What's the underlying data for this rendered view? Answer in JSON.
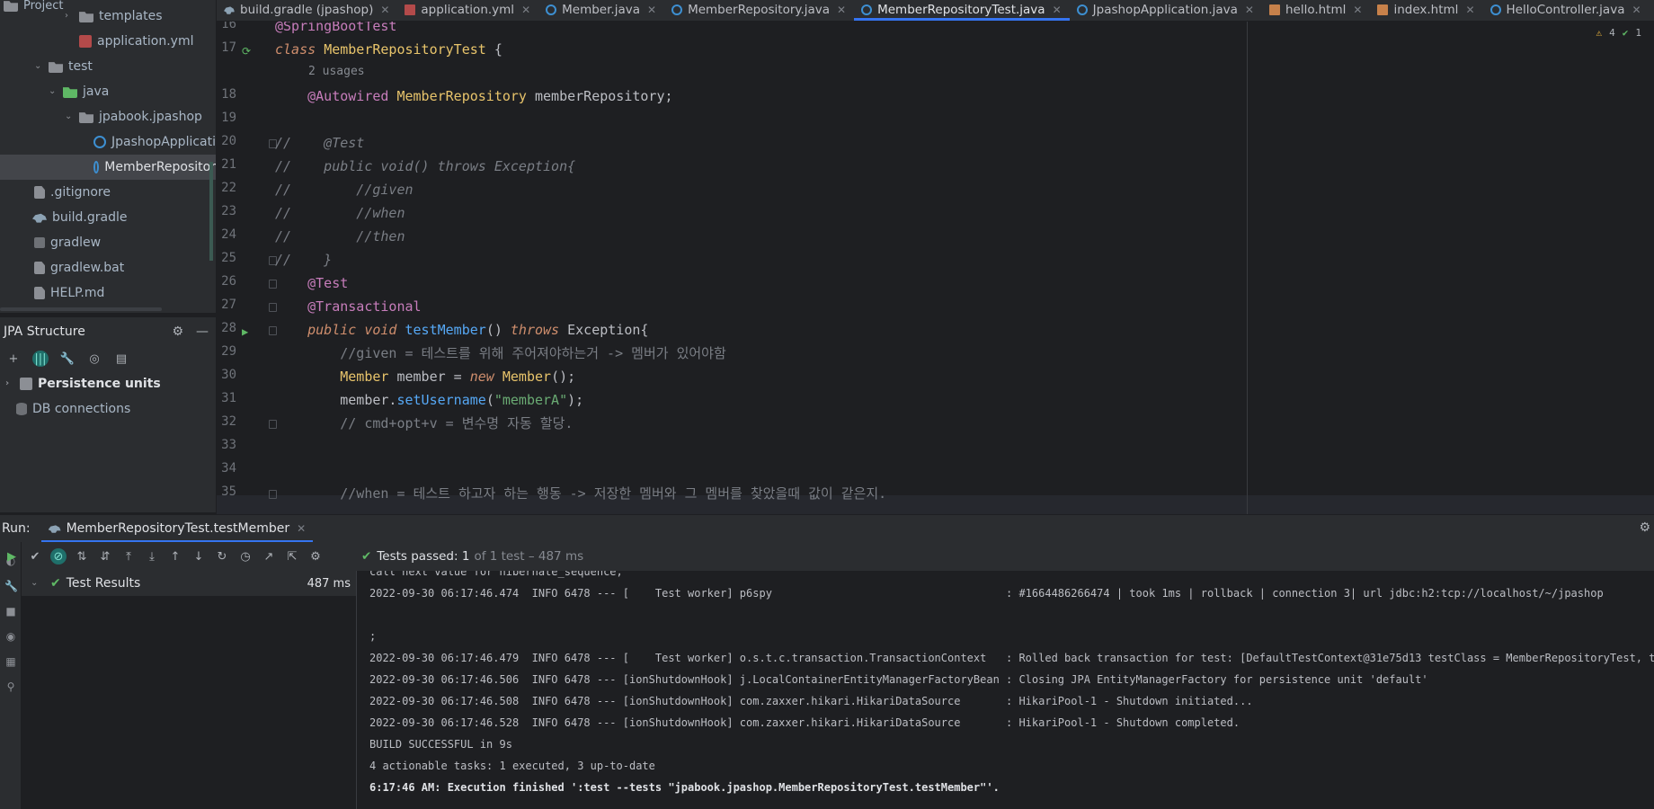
{
  "project": {
    "header_partial": "Project",
    "items": [
      {
        "label": "templates",
        "icon": "folder-icon"
      },
      {
        "label": "application.yml",
        "icon": "yaml-file-icon"
      },
      {
        "label": "test",
        "icon": "folder-icon"
      },
      {
        "label": "java",
        "icon": "folder-icon"
      },
      {
        "label": "jpabook.jpashop",
        "icon": "package-icon"
      },
      {
        "label": "JpashopApplicati",
        "icon": "class-icon"
      },
      {
        "label": "MemberRepositor",
        "icon": "class-icon"
      },
      {
        "label": ".gitignore",
        "icon": "file-icon"
      },
      {
        "label": "build.gradle",
        "icon": "gradle-icon"
      },
      {
        "label": "gradlew",
        "icon": "terminal-icon"
      },
      {
        "label": "gradlew.bat",
        "icon": "file-icon"
      },
      {
        "label": "HELP.md",
        "icon": "markdown-icon"
      }
    ]
  },
  "jpa": {
    "title": "JPA Structure",
    "items": [
      {
        "label": "Persistence units"
      },
      {
        "label": "DB connections"
      }
    ]
  },
  "tabs": [
    {
      "label": "build.gradle (jpashop)",
      "icon": "gradle-icon"
    },
    {
      "label": "application.yml",
      "icon": "yaml-icon"
    },
    {
      "label": "Member.java",
      "icon": "class-icon"
    },
    {
      "label": "MemberRepository.java",
      "icon": "class-icon"
    },
    {
      "label": "MemberRepositoryTest.java",
      "icon": "class-icon",
      "active": true
    },
    {
      "label": "JpashopApplication.java",
      "icon": "class-icon"
    },
    {
      "label": "hello.html",
      "icon": "html-icon"
    },
    {
      "label": "index.html",
      "icon": "html-icon"
    },
    {
      "label": "HelloController.java",
      "icon": "class-icon"
    }
  ],
  "editor": {
    "inspections": {
      "warnings": "4",
      "ok": "1"
    },
    "usages": "2 usages",
    "lines": [
      {
        "n": "16",
        "text": "@SpringBootTest"
      },
      {
        "n": "17",
        "text": "class MemberRepositoryTest {"
      },
      {
        "n": "18",
        "text": "    @Autowired MemberRepository memberRepository;"
      },
      {
        "n": "19",
        "text": ""
      },
      {
        "n": "20",
        "text": "//    @Test"
      },
      {
        "n": "21",
        "text": "//    public void() throws Exception{"
      },
      {
        "n": "22",
        "text": "//        //given"
      },
      {
        "n": "23",
        "text": "//        //when"
      },
      {
        "n": "24",
        "text": "//        //then"
      },
      {
        "n": "25",
        "text": "//    }"
      },
      {
        "n": "26",
        "text": "    @Test"
      },
      {
        "n": "27",
        "text": "    @Transactional"
      },
      {
        "n": "28",
        "text": "    public void testMember() throws Exception{"
      },
      {
        "n": "29",
        "text": "        //given = 테스트를 위해 주어져야하는거 -> 멤버가 있어야함"
      },
      {
        "n": "30",
        "text": "        Member member = new Member();"
      },
      {
        "n": "31",
        "text": "        member.setUsername(\"memberA\");"
      },
      {
        "n": "32",
        "text": "        // cmd+opt+v = 변수명 자동 할당."
      },
      {
        "n": "33",
        "text": ""
      },
      {
        "n": "34",
        "text": ""
      },
      {
        "n": "35",
        "text": "        //when = 테스트 하고자 하는 행동 -> 저장한 멤버와 그 멤버를 찾았을때 값이 같은지."
      }
    ]
  },
  "run": {
    "label": "Run:",
    "tab": "MemberRepositoryTest.testMember",
    "status_main": "Tests passed: 1",
    "status_rest": "of 1 test – 487 ms",
    "results_label": "Test Results",
    "results_time": "487 ms",
    "console": [
      "call next value for hibernate_sequence;",
      "2022-09-30 06:17:46.474  INFO 6478 --- [    Test worker] p6spy                                    : #1664486266474 | took 1ms | rollback | connection 3| url jdbc:h2:tcp://localhost/~/jpashop",
      "",
      ";",
      "2022-09-30 06:17:46.479  INFO 6478 --- [    Test worker] o.s.t.c.transaction.TransactionContext   : Rolled back transaction for test: [DefaultTestContext@31e75d13 testClass = MemberRepositoryTest, testIn",
      "2022-09-30 06:17:46.506  INFO 6478 --- [ionShutdownHook] j.LocalContainerEntityManagerFactoryBean : Closing JPA EntityManagerFactory for persistence unit 'default'",
      "2022-09-30 06:17:46.508  INFO 6478 --- [ionShutdownHook] com.zaxxer.hikari.HikariDataSource       : HikariPool-1 - Shutdown initiated...",
      "2022-09-30 06:17:46.528  INFO 6478 --- [ionShutdownHook] com.zaxxer.hikari.HikariDataSource       : HikariPool-1 - Shutdown completed.",
      "BUILD SUCCESSFUL in 9s",
      "4 actionable tasks: 1 executed, 3 up-to-date",
      "6:17:46 AM: Execution finished ':test --tests \"jpabook.jpashop.MemberRepositoryTest.testMember\"'."
    ]
  }
}
